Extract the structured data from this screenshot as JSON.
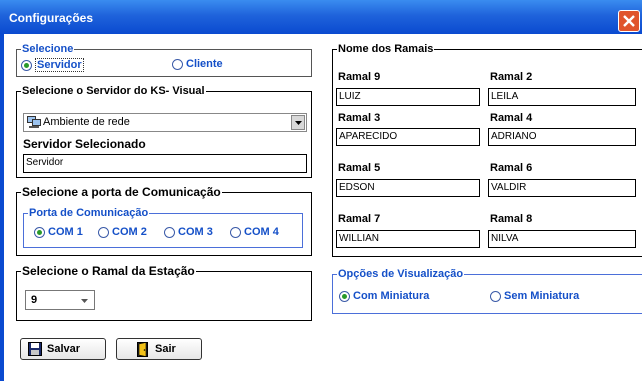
{
  "window": {
    "title": "Configurações"
  },
  "selecione": {
    "legend": "Selecione",
    "options": [
      {
        "label": "Servidor",
        "checked": true
      },
      {
        "label": "Cliente",
        "checked": false
      }
    ]
  },
  "servidor": {
    "legend": "Selecione o Servidor do KS- Visual",
    "combo_value": "Ambiente de rede",
    "selected_label": "Servidor Selecionado",
    "selected_value": "Servidor"
  },
  "porta": {
    "legend": "Selecione a porta de Comunicação",
    "inner_legend": "Porta de Comunicação",
    "options": [
      {
        "label": "COM 1",
        "checked": true
      },
      {
        "label": "COM 2",
        "checked": false
      },
      {
        "label": "COM 3",
        "checked": false
      },
      {
        "label": "COM 4",
        "checked": false
      }
    ]
  },
  "ramal_estacao": {
    "legend": "Selecione o Ramal da Estação",
    "value": "9"
  },
  "ramais": {
    "legend": "Nome dos Ramais",
    "items": [
      {
        "label": "Ramal 9",
        "value": "LUIZ"
      },
      {
        "label": "Ramal 2",
        "value": "LEILA"
      },
      {
        "label": "Ramal 3",
        "value": "APARECIDO"
      },
      {
        "label": "Ramal 4",
        "value": "ADRIANO"
      },
      {
        "label": "Ramal 5",
        "value": "EDSON"
      },
      {
        "label": "Ramal 6",
        "value": "VALDIR"
      },
      {
        "label": "Ramal 7",
        "value": "WILLIAN"
      },
      {
        "label": "Ramal 8",
        "value": "NILVA"
      }
    ]
  },
  "visualizacao": {
    "legend": "Opções de Visualização",
    "options": [
      {
        "label": "Com Miniatura",
        "checked": true
      },
      {
        "label": "Sem Miniatura",
        "checked": false
      }
    ]
  },
  "buttons": {
    "save": "Salvar",
    "exit": "Sair"
  },
  "colors": {
    "title_bar": "#1f63db",
    "accent_text": "#1550c8",
    "radio_selected": "#2a9a2a",
    "close_button": "#e0542c"
  },
  "icons": {
    "network": "network-computer-icon",
    "save": "floppy-disk-icon",
    "exit": "door-exit-icon",
    "close": "close-x-icon"
  }
}
